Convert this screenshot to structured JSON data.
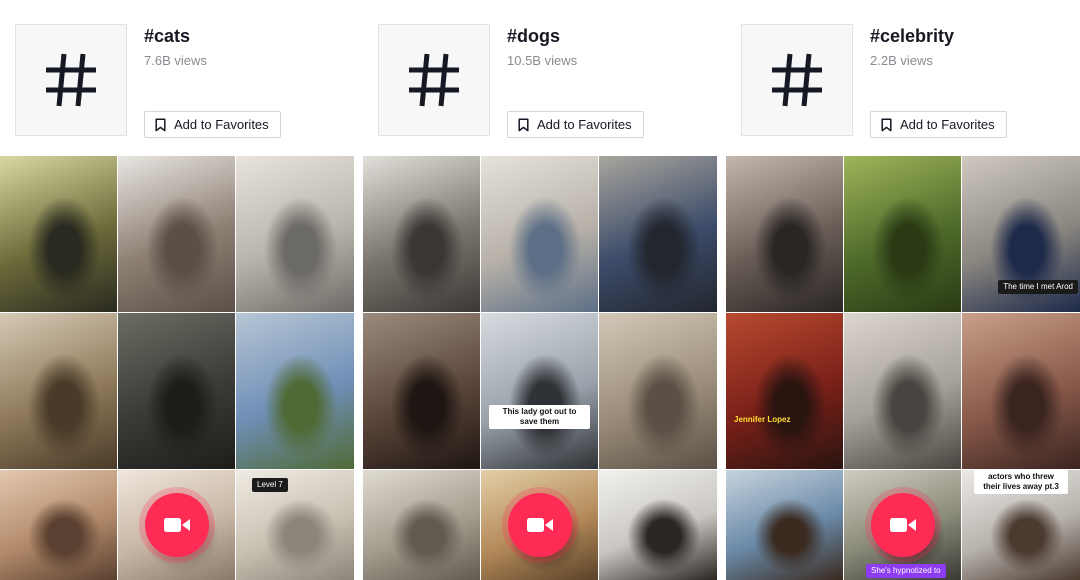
{
  "hashtags": [
    {
      "title": "#cats",
      "views": "7.6B views",
      "favorite_label": "Add to Favorites",
      "videos": [
        {
          "colors": [
            "#6d6b3a",
            "#d8d9a2",
            "#2a2a20"
          ]
        },
        {
          "colors": [
            "#8d7f73",
            "#e9e6e3",
            "#5a5047"
          ]
        },
        {
          "colors": [
            "#b9b4ab",
            "#e8e4dd",
            "#6c6a66"
          ]
        },
        {
          "colors": [
            "#8e7a5a",
            "#d6c9b5",
            "#4a3a28"
          ]
        },
        {
          "colors": [
            "#3a3a36",
            "#6b6d63",
            "#1d1d1a"
          ]
        },
        {
          "colors": [
            "#6f8fb7",
            "#b7c6d5",
            "#4f6a35"
          ]
        },
        {
          "colors": [
            "#b28a6a",
            "#e4c8b0",
            "#5a4030"
          ]
        },
        {
          "colors": [
            "#c8b7a5",
            "#efe6dc",
            "#8a7a6a"
          ],
          "record": true
        },
        {
          "colors": [
            "#c9c1b3",
            "#f0ebe3",
            "#8c857a"
          ],
          "caption": "Level 7",
          "caption_style": "dark"
        }
      ]
    },
    {
      "title": "#dogs",
      "views": "10.5B views",
      "favorite_label": "Add to Favorites",
      "videos": [
        {
          "colors": [
            "#7a756e",
            "#e3e0db",
            "#3b3834"
          ]
        },
        {
          "colors": [
            "#b7b1a8",
            "#e6e2dc",
            "#5d6f86"
          ]
        },
        {
          "colors": [
            "#3d4c6a",
            "#a8a59d",
            "#22262e"
          ]
        },
        {
          "colors": [
            "#5b463a",
            "#9a8b7e",
            "#1e1612"
          ]
        },
        {
          "colors": [
            "#9aa2ab",
            "#d7dbe0",
            "#2f3236"
          ],
          "caption": "This lady got out to save them",
          "caption_style": "white"
        },
        {
          "colors": [
            "#9b8d7a",
            "#d3c8b8",
            "#5a5045"
          ]
        },
        {
          "colors": [
            "#a59d8f",
            "#e0dbd2",
            "#615a4f"
          ]
        },
        {
          "colors": [
            "#b48a5a",
            "#e4cfa7",
            "#5a4228"
          ],
          "record": true
        },
        {
          "colors": [
            "#c9c6c2",
            "#f2f1ef",
            "#2b2622"
          ]
        }
      ]
    },
    {
      "title": "#celebrity",
      "views": "2.2B views",
      "favorite_label": "Add to Favorites",
      "videos": [
        {
          "colors": [
            "#6a5e57",
            "#c4b8ae",
            "#2a2624"
          ]
        },
        {
          "colors": [
            "#4f6a2a",
            "#9fb55a",
            "#2a3a14"
          ]
        },
        {
          "colors": [
            "#8a8680",
            "#cfc9c0",
            "#1e2a4a"
          ],
          "caption": "The time I met Arod",
          "caption_style": "dark"
        },
        {
          "colors": [
            "#7a2018",
            "#b84a30",
            "#2a1410"
          ],
          "caption": "Jennifer Lopez",
          "caption_style": "yellow"
        },
        {
          "colors": [
            "#a6a09a",
            "#dcd6cf",
            "#4a4440"
          ]
        },
        {
          "colors": [
            "#8a5a4a",
            "#c8a08a",
            "#3a2420"
          ]
        },
        {
          "colors": [
            "#6a8aa8",
            "#c7d3de",
            "#3a2a20"
          ]
        },
        {
          "colors": [
            "#8a8a7a",
            "#d0cdc0",
            "#3a3a34"
          ],
          "record": true,
          "caption": "She's hypnotized to",
          "caption_style": "purple"
        },
        {
          "colors": [
            "#b7b2ac",
            "#ece9e5",
            "#4a3a30"
          ],
          "caption": "actors who threw their lives away pt.3",
          "caption_style": "white"
        }
      ]
    }
  ],
  "theme": {
    "accent": "#fe2c55",
    "text": "#161823",
    "muted": "#8a8b91"
  }
}
